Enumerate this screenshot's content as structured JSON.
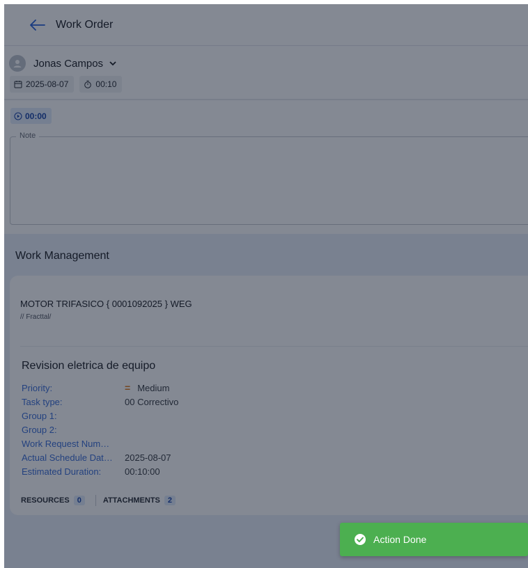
{
  "header": {
    "title": "Work Order",
    "back_icon": "arrow-left-icon"
  },
  "user": {
    "name": "Jonas Campos",
    "date": "2025-08-07",
    "duration": "00:10"
  },
  "timer": {
    "value": "00:00"
  },
  "note": {
    "label": "Note",
    "value": ""
  },
  "work_management": {
    "title": "Work Management",
    "asset": {
      "name": "MOTOR TRIFASICO { 0001092025 } WEG",
      "path": "// Fracttal/"
    },
    "task": {
      "title": "Revision eletrica de equipo",
      "fields": [
        {
          "label": "Priority:",
          "value": "Medium"
        },
        {
          "label": "Task type:",
          "value": "00 Correctivo"
        },
        {
          "label": "Group 1:",
          "value": ""
        },
        {
          "label": "Group 2:",
          "value": ""
        },
        {
          "label": "Work Request Num…",
          "value": ""
        },
        {
          "label": "Actual Schedule Dat…",
          "value": "2025-08-07"
        },
        {
          "label": "Estimated Duration:",
          "value": "00:10:00"
        }
      ]
    },
    "resources": {
      "label": "RESOURCES",
      "count": "0"
    },
    "attachments": {
      "label": "ATTACHMENTS",
      "count": "2"
    }
  },
  "toast": {
    "message": "Action Done",
    "icon": "check-circle-icon"
  },
  "colors": {
    "accent": "#3d6fd6",
    "toast_bg": "#4caf50",
    "priority_medium": "#e07a1f",
    "section_bg": "#e8eff9"
  }
}
